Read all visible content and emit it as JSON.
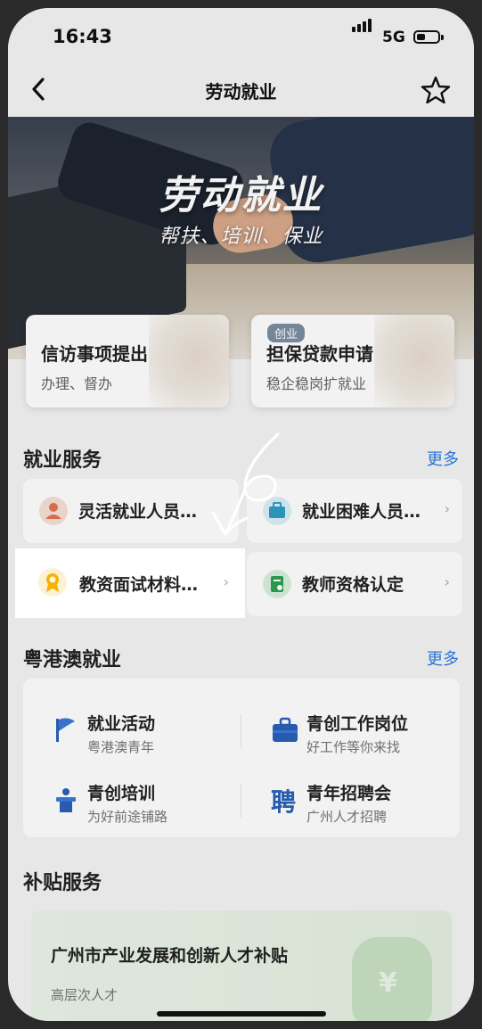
{
  "status_bar": {
    "time": "16:43",
    "network": "5G"
  },
  "nav": {
    "title": "劳动就业"
  },
  "hero": {
    "title": "劳动就业",
    "subtitle": "帮扶、培训、保业"
  },
  "quick_cards": [
    {
      "title": "信访事项提出",
      "subtitle": "办理、督办",
      "tag": ""
    },
    {
      "title": "担保贷款申请",
      "subtitle": "稳企稳岗扩就业",
      "tag": "创业"
    }
  ],
  "employment_services": {
    "title": "就业服务",
    "more": "更多",
    "items": [
      {
        "label": "灵活就业人员…",
        "icon": "people-icon"
      },
      {
        "label": "就业困难人员…",
        "icon": "briefcase-icon"
      },
      {
        "label": "教资面试材料…",
        "icon": "award-ribbon-icon"
      },
      {
        "label": "教师资格认定",
        "icon": "certificate-icon"
      }
    ]
  },
  "gba_employment": {
    "title": "粤港澳就业",
    "more": "更多",
    "items": [
      {
        "title": "就业活动",
        "subtitle": "粤港澳青年",
        "icon": "flag-icon"
      },
      {
        "title": "青创工作岗位",
        "subtitle": "好工作等你来找",
        "icon": "briefcase-icon"
      },
      {
        "title": "青创培训",
        "subtitle": "为好前途铺路",
        "icon": "podium-icon"
      },
      {
        "title": "青年招聘会",
        "subtitle": "广州人才招聘",
        "icon": "hire-icon"
      }
    ]
  },
  "subsidy": {
    "title": "补贴服务",
    "card": {
      "title": "广州市产业发展和创新人才补贴",
      "subtitle": "高层次人才",
      "icon": "money-bag-icon"
    }
  },
  "annotation": {
    "mark": "6",
    "arrow": "hand-drawn-arrow"
  },
  "colors": {
    "accent": "#2c7be5",
    "page_bg": "#f4f4f5",
    "card_bg": "#ffffff"
  }
}
